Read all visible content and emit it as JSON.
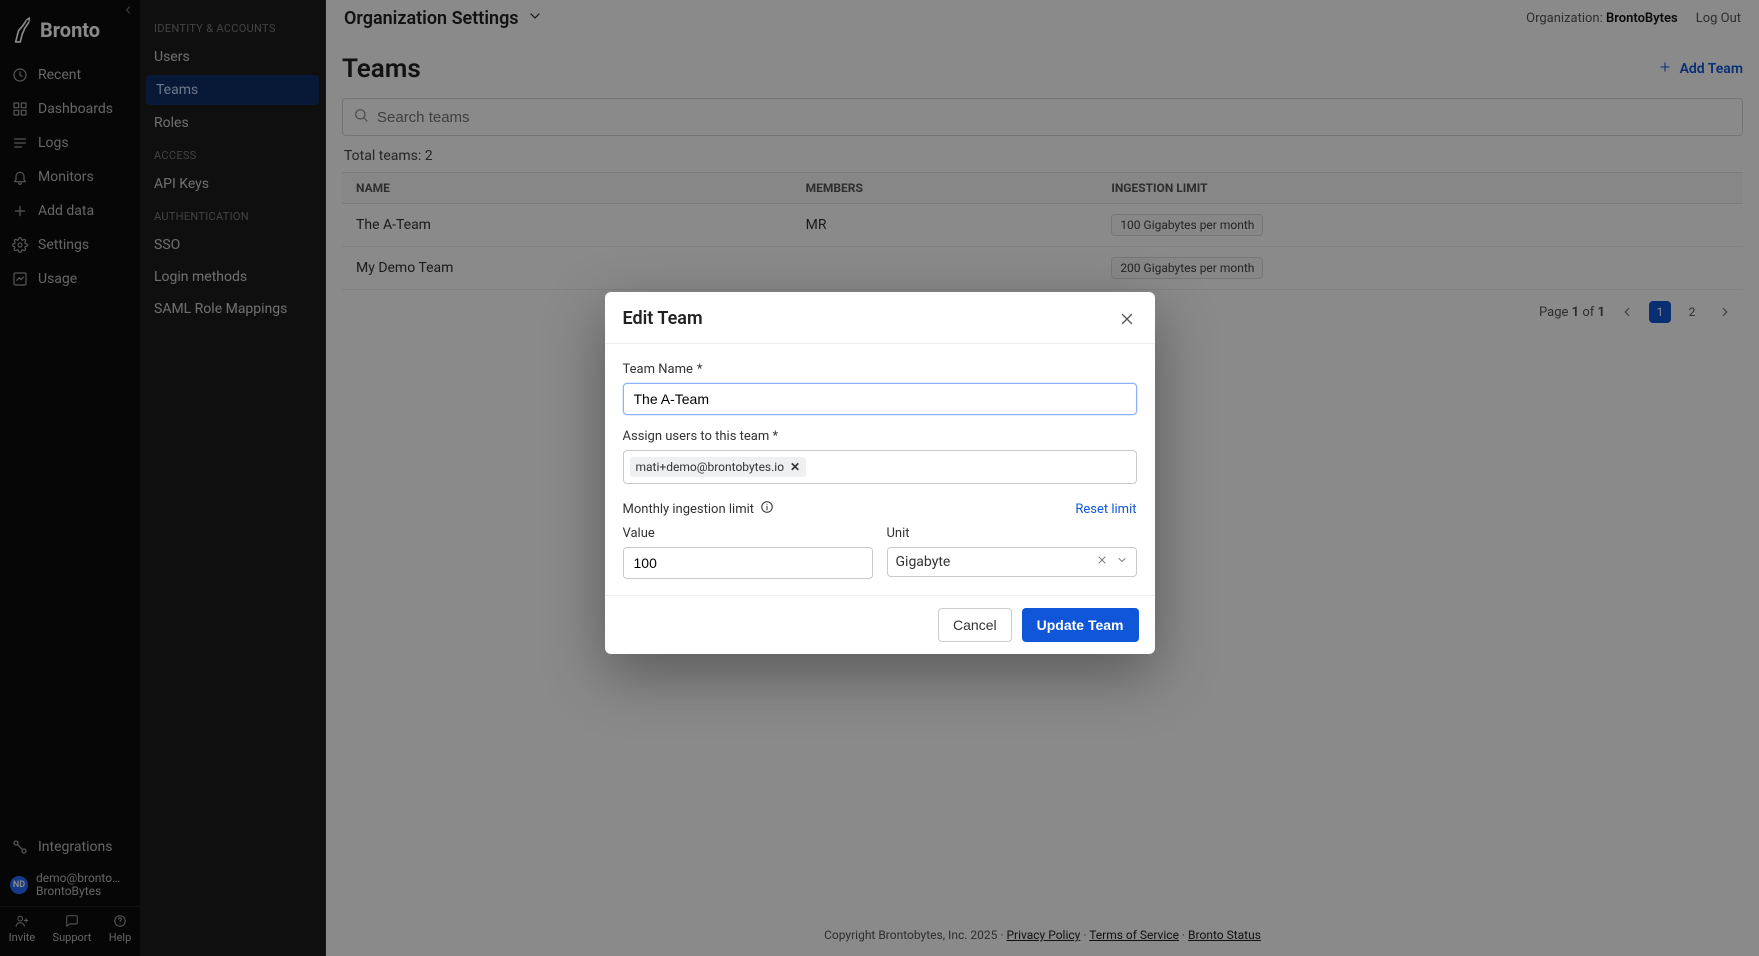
{
  "brand": {
    "name": "Bronto"
  },
  "rail": {
    "items": [
      {
        "label": "Recent"
      },
      {
        "label": "Dashboards"
      },
      {
        "label": "Logs"
      },
      {
        "label": "Monitors"
      },
      {
        "label": "Add data"
      },
      {
        "label": "Settings"
      },
      {
        "label": "Usage"
      }
    ],
    "integrations": "Integrations",
    "user": {
      "initials": "ND",
      "email": "demo@brontoby...",
      "org": "BrontoBytes"
    },
    "footer": {
      "invite": "Invite",
      "support": "Support",
      "help": "Help"
    }
  },
  "header": {
    "title": "Organization Settings",
    "org_label": "Organization:",
    "org_name": "BrontoBytes",
    "logout": "Log Out"
  },
  "subside": {
    "groups": [
      {
        "label": "IDENTITY & ACCOUNTS",
        "items": [
          "Users",
          "Teams",
          "Roles"
        ],
        "activeIndex": 1
      },
      {
        "label": "ACCESS",
        "items": [
          "API Keys"
        ]
      },
      {
        "label": "AUTHENTICATION",
        "items": [
          "SSO",
          "Login methods",
          "SAML Role Mappings"
        ]
      }
    ]
  },
  "page": {
    "title": "Teams",
    "add_team_label": "Add Team",
    "search_placeholder": "Search teams",
    "totals_prefix": "Total teams:",
    "totals_count": "2",
    "columns": {
      "name": "NAME",
      "members": "MEMBERS",
      "limit": "INGESTION LIMIT"
    },
    "rows": [
      {
        "name": "The A-Team",
        "members": "MR",
        "limit": "100 Gigabytes per month"
      },
      {
        "name": "My Demo Team",
        "members": "",
        "limit": "200 Gigabytes per month"
      }
    ],
    "pager": {
      "label_prefix": "Page",
      "current": "1",
      "of": "of",
      "total": "1",
      "pages": [
        "1",
        "2"
      ]
    }
  },
  "footer": {
    "copyright": "Copyright Brontobytes, Inc. 2025",
    "sep": " · ",
    "privacy": "Privacy Policy",
    "terms": "Terms of Service",
    "status": "Bronto Status"
  },
  "modal": {
    "title": "Edit Team",
    "team_name_label": "Team Name",
    "team_name_value": "The A-Team",
    "assign_label": "Assign users to this team *",
    "chip_user": "mati+demo@brontobytes.io",
    "limit_label": "Monthly ingestion limit",
    "reset_label": "Reset limit",
    "value_label": "Value",
    "value": "100",
    "unit_label": "Unit",
    "unit_value": "Gigabyte",
    "cancel": "Cancel",
    "submit": "Update Team",
    "required_mark": "*"
  }
}
